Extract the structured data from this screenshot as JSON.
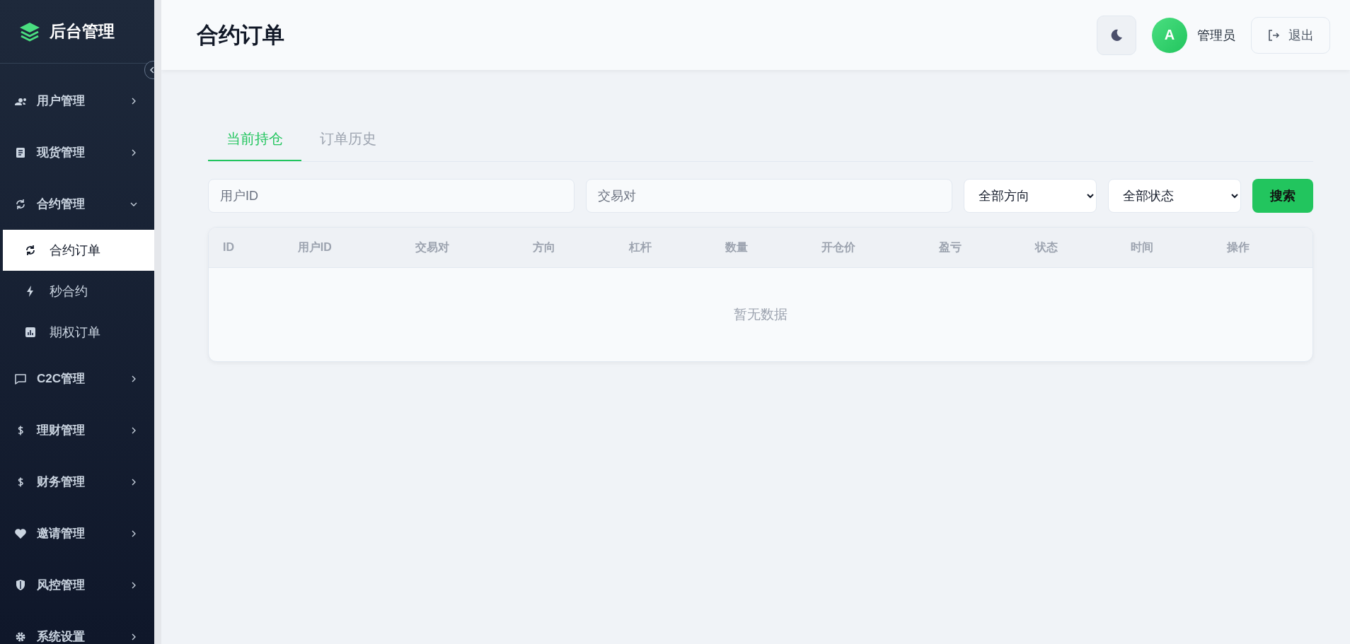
{
  "sidebar": {
    "logo": "后台管理",
    "items": [
      {
        "label": "用户管理",
        "expanded": false
      },
      {
        "label": "现货管理",
        "expanded": false
      },
      {
        "label": "合约管理",
        "expanded": true,
        "children": [
          {
            "label": "合约订单",
            "selected": true
          },
          {
            "label": "秒合约",
            "selected": false
          },
          {
            "label": "期权订单",
            "selected": false
          }
        ]
      },
      {
        "label": "C2C管理",
        "expanded": false
      },
      {
        "label": "理财管理",
        "expanded": false
      },
      {
        "label": "财务管理",
        "expanded": false
      },
      {
        "label": "邀请管理",
        "expanded": false
      },
      {
        "label": "风控管理",
        "expanded": false
      },
      {
        "label": "系统设置",
        "expanded": false
      }
    ]
  },
  "header": {
    "title": "合约订单",
    "avatar": "A",
    "user": "管理员",
    "logout": "退出"
  },
  "tabs": [
    {
      "label": "当前持仓",
      "selected": true
    },
    {
      "label": "订单历史",
      "selected": false
    }
  ],
  "filters": {
    "user_id": {
      "placeholder": "用户ID"
    },
    "pair": {
      "placeholder": "交易对"
    },
    "direction": "全部方向",
    "status": "全部状态",
    "search": "搜索"
  },
  "table": {
    "columns": [
      "ID",
      "用户ID",
      "交易对",
      "方向",
      "杠杆",
      "数量",
      "开仓价",
      "盈亏",
      "状态",
      "时间",
      "操作"
    ],
    "empty": "暂无数据"
  }
}
